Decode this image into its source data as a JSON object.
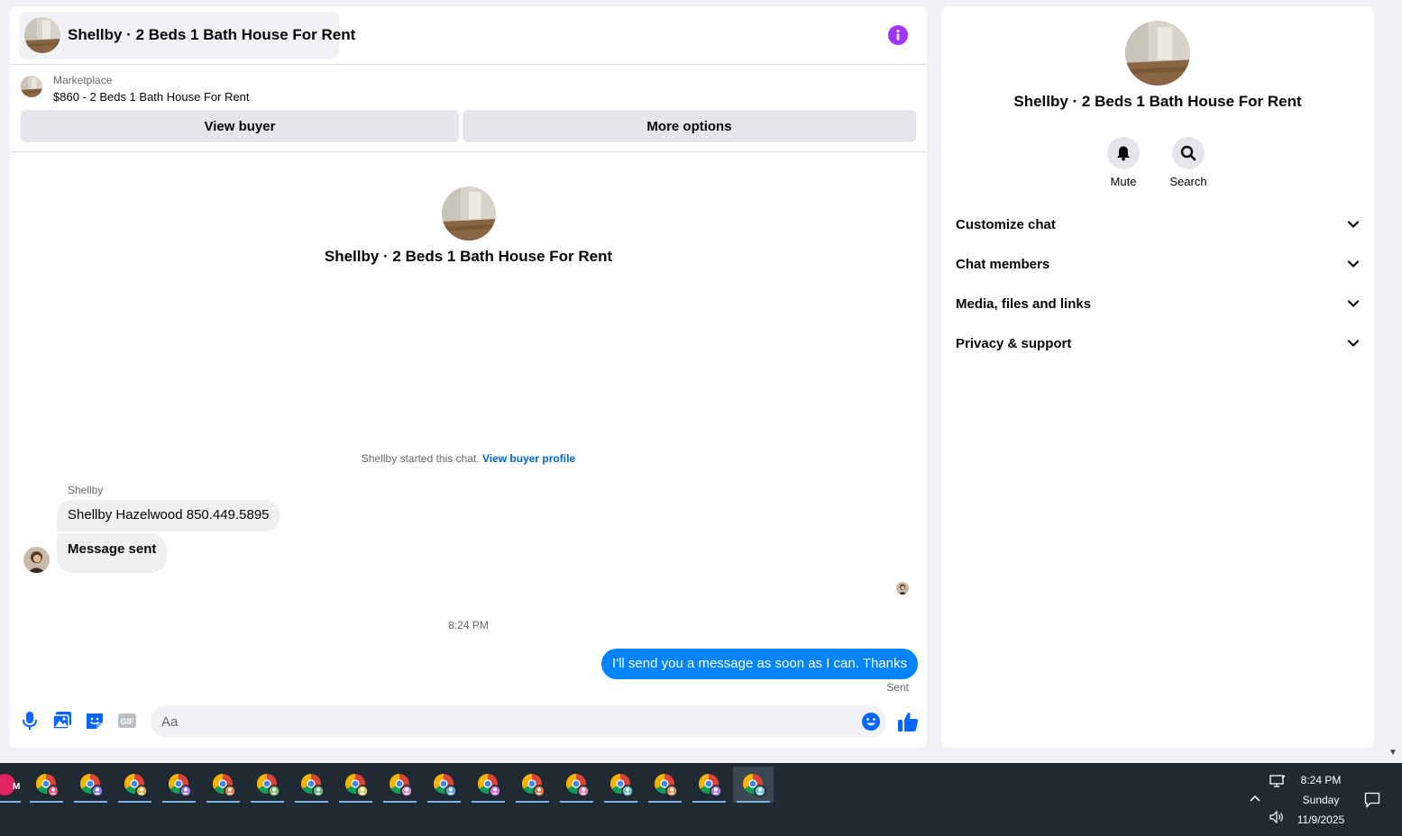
{
  "header": {
    "title": "Shellby · 2 Beds 1 Bath House For Rent"
  },
  "listing": {
    "label": "Marketplace",
    "title": "$860 - 2 Beds 1 Bath House For Rent",
    "view_buyer": "View buyer",
    "more_options": "More options"
  },
  "thread": {
    "intro_name": "Shellby · 2 Beds 1 Bath House For Rent",
    "started_text": "Shellby started this chat.",
    "started_link": "View buyer profile",
    "sender_name": "Shellby",
    "messages_in": [
      "Shellby Hazelwood 850.449.5895",
      "Message sent"
    ],
    "timestamp": "8:24 PM",
    "message_out": "I'll send you a message as soon as I can. Thanks",
    "status": "Sent"
  },
  "composer": {
    "placeholder": "Aa",
    "icons": [
      "microphone-icon",
      "photo-icon",
      "sticker-icon",
      "gif-icon",
      "emoji-icon",
      "thumbs-up-icon"
    ]
  },
  "info_panel": {
    "name": "Shellby · 2 Beds 1 Bath House For Rent",
    "actions": [
      {
        "label": "Mute",
        "icon": "bell-icon"
      },
      {
        "label": "Search",
        "icon": "search-icon"
      }
    ],
    "sections": [
      "Customize chat",
      "Chat members",
      "Media, files and links",
      "Privacy & support"
    ]
  },
  "taskbar": {
    "time": "8:24 PM",
    "day": "Sunday",
    "date": "11/9/2025",
    "badge_letter": "M"
  },
  "colors": {
    "accent": "#0084ff",
    "link": "#0064d1",
    "info": "#a033ff",
    "taskbar": "#1f2a33"
  }
}
